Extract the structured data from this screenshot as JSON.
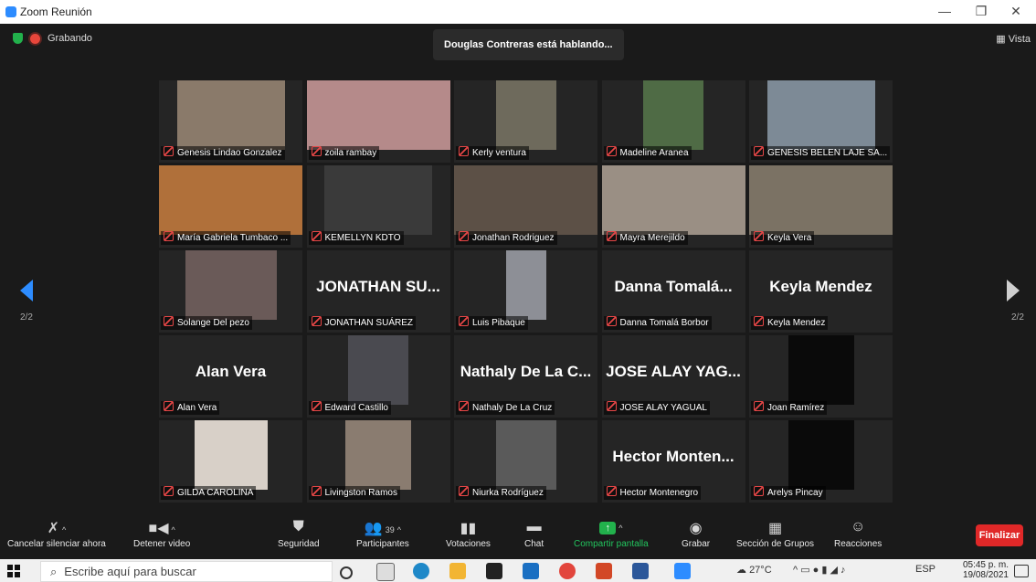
{
  "window": {
    "title": "Zoom Reunión",
    "minimize": "—",
    "restore": "❐",
    "close": "✕"
  },
  "top": {
    "recording": "Grabando",
    "speaking": "Douglas Contreras está hablando...",
    "view": "Vista"
  },
  "page_indicator_left": "2/2",
  "page_indicator_right": "2/2",
  "tiles": [
    {
      "name": "Genesis Lindao Gonzalez",
      "big": "",
      "video": true
    },
    {
      "name": "zoila rambay",
      "big": "",
      "video": true
    },
    {
      "name": "Kerly ventura",
      "big": "",
      "video": true
    },
    {
      "name": "Madeline Aranea",
      "big": "",
      "video": true
    },
    {
      "name": "GENESIS BELEN LAJE SA...",
      "big": "",
      "video": true
    },
    {
      "name": "María Gabriela Tumbaco ...",
      "big": "",
      "video": true
    },
    {
      "name": "KEMELLYN KDTO",
      "big": "",
      "video": true
    },
    {
      "name": "Jonathan Rodriguez",
      "big": "",
      "video": true
    },
    {
      "name": "Mayra Merejildo",
      "big": "",
      "video": true
    },
    {
      "name": "Keyla Vera",
      "big": "",
      "video": true
    },
    {
      "name": "Solange Del pezo",
      "big": "",
      "video": true
    },
    {
      "name": "JONATHAN SUÁREZ",
      "big": "JONATHAN SU...",
      "video": false
    },
    {
      "name": "Luis Pibaque",
      "big": "",
      "video": true
    },
    {
      "name": "Danna Tomalá Borbor",
      "big": "Danna Tomalá...",
      "video": false
    },
    {
      "name": "Keyla Mendez",
      "big": "Keyla Mendez",
      "video": false
    },
    {
      "name": "Alan Vera",
      "big": "Alan Vera",
      "video": false
    },
    {
      "name": "Edward Castillo",
      "big": "",
      "video": true
    },
    {
      "name": "Nathaly De La Cruz",
      "big": "Nathaly De La C...",
      "video": false
    },
    {
      "name": "JOSE ALAY YAGUAL",
      "big": "JOSE ALAY YAG...",
      "video": false
    },
    {
      "name": "Joan Ramírez",
      "big": "",
      "video": true
    },
    {
      "name": "GILDA CAROLINA",
      "big": "",
      "video": true
    },
    {
      "name": "Livingston Ramos",
      "big": "",
      "video": true
    },
    {
      "name": "Niurka Rodríguez",
      "big": "",
      "video": true
    },
    {
      "name": "Hector Montenegro",
      "big": "Hector Monten...",
      "video": false
    },
    {
      "name": "Arelys Pincay",
      "big": "",
      "video": true
    }
  ],
  "toolbar": {
    "unmute": "Cancelar silenciar ahora",
    "stop_video": "Detener video",
    "security": "Seguridad",
    "participants": "Participantes",
    "participants_count": "39",
    "polls": "Votaciones",
    "chat": "Chat",
    "share": "Compartir pantalla",
    "record": "Grabar",
    "breakout": "Sección de Grupos",
    "reactions": "Reacciones",
    "end": "Finalizar"
  },
  "taskbar": {
    "search_placeholder": "Escribe aquí para buscar",
    "temp": "27°C",
    "lang": "ESP",
    "time": "05:45 p. m.",
    "date": "19/08/2021"
  },
  "colors": {
    "accent": "#2d8cff",
    "end": "#e02828",
    "share": "#22b14c",
    "muted": "#e64646"
  }
}
